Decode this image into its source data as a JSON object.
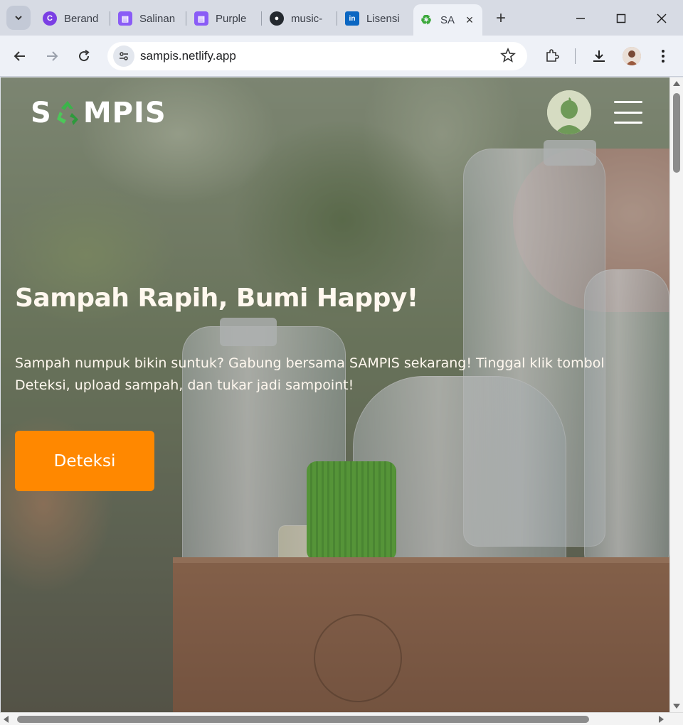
{
  "browser": {
    "tabs": [
      {
        "title": "Berand",
        "icon": "canva-icon",
        "color": "#7b3fe4"
      },
      {
        "title": "Salinan",
        "icon": "document-icon",
        "color": "#8a5cf6"
      },
      {
        "title": "Purple",
        "icon": "document-icon",
        "color": "#8a5cf6"
      },
      {
        "title": "music-",
        "icon": "github-icon",
        "color": "#24292f"
      },
      {
        "title": "Lisensi",
        "icon": "linkedin-icon",
        "color": "#0a66c2"
      },
      {
        "title": "SA",
        "icon": "recycle-icon",
        "color": "#3aa83a",
        "active": true
      }
    ],
    "url": "sampis.netlify.app"
  },
  "page": {
    "logo": {
      "left": "S",
      "right": "MPIS"
    },
    "headline": "Sampah Rapih, Bumi Happy!",
    "subtext": "Sampah numpuk bikin suntuk? Gabung bersama SAMPIS sekarang! Tinggal klik tombol Deteksi, upload sampah, dan tukar jadi sampoint!",
    "cta_label": "Deteksi",
    "accent": "#ff8800"
  }
}
